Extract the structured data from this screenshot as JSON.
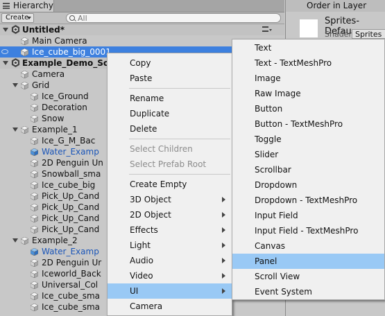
{
  "hierarchy": {
    "tab_label": "Hierarchy",
    "create_label": "Create",
    "search_placeholder": "All",
    "rows": [
      {
        "label": "Untitled*",
        "type": "scene"
      },
      {
        "label": "Main Camera",
        "type": "object"
      },
      {
        "label": "Ice_cube_big_0001",
        "type": "object",
        "selected": true
      },
      {
        "label": "Example_Demo_Sc",
        "type": "scene"
      },
      {
        "label": "Camera",
        "type": "object"
      },
      {
        "label": "Grid",
        "type": "object"
      },
      {
        "label": "Ice_Ground",
        "type": "object"
      },
      {
        "label": "Decoration",
        "type": "object"
      },
      {
        "label": "Snow",
        "type": "object"
      },
      {
        "label": "Example_1",
        "type": "object"
      },
      {
        "label": "Ice_G_M_Bac",
        "type": "object"
      },
      {
        "label": "Water_Examp",
        "type": "prefab"
      },
      {
        "label": "2D Penguin Un",
        "type": "object"
      },
      {
        "label": "Snowball_sma",
        "type": "object"
      },
      {
        "label": "Ice_cube_big",
        "type": "object"
      },
      {
        "label": "Pick_Up_Cand",
        "type": "object"
      },
      {
        "label": "Pick_Up_Cand",
        "type": "object"
      },
      {
        "label": "Pick_Up_Cand",
        "type": "object"
      },
      {
        "label": "Pick_Up_Cand",
        "type": "object"
      },
      {
        "label": "Example_2",
        "type": "object"
      },
      {
        "label": "Water_Examp",
        "type": "prefab"
      },
      {
        "label": "2D Penguin Ur",
        "type": "object"
      },
      {
        "label": "Iceworld_Back",
        "type": "object"
      },
      {
        "label": "Universal_Col",
        "type": "object"
      },
      {
        "label": "Ice_cube_sma",
        "type": "object"
      },
      {
        "label": "Ice_cube_sma",
        "type": "object"
      }
    ]
  },
  "inspector": {
    "top_label": "Order in Layer",
    "title": "Sprites-Defau",
    "shader_label": "Shader",
    "shader_value": "Sprites"
  },
  "context_menu": {
    "items": [
      {
        "label": "Copy"
      },
      {
        "label": "Paste"
      },
      {
        "label": "Rename"
      },
      {
        "label": "Duplicate"
      },
      {
        "label": "Delete"
      },
      {
        "label": "Select Children",
        "disabled": true
      },
      {
        "label": "Select Prefab Root",
        "disabled": true
      },
      {
        "label": "Create Empty"
      },
      {
        "label": "3D Object",
        "submenu": true
      },
      {
        "label": "2D Object",
        "submenu": true
      },
      {
        "label": "Effects",
        "submenu": true
      },
      {
        "label": "Light",
        "submenu": true
      },
      {
        "label": "Audio",
        "submenu": true
      },
      {
        "label": "Video",
        "submenu": true
      },
      {
        "label": "UI",
        "submenu": true,
        "highlighted": true
      },
      {
        "label": "Camera"
      }
    ]
  },
  "ui_submenu": {
    "items": [
      {
        "label": "Text"
      },
      {
        "label": "Text - TextMeshPro"
      },
      {
        "label": "Image"
      },
      {
        "label": "Raw Image"
      },
      {
        "label": "Button"
      },
      {
        "label": "Button - TextMeshPro"
      },
      {
        "label": "Toggle"
      },
      {
        "label": "Slider"
      },
      {
        "label": "Scrollbar"
      },
      {
        "label": "Dropdown"
      },
      {
        "label": "Dropdown - TextMeshPro"
      },
      {
        "label": "Input Field"
      },
      {
        "label": "Input Field - TextMeshPro"
      },
      {
        "label": "Canvas"
      },
      {
        "label": "Panel",
        "highlighted": true
      },
      {
        "label": "Scroll View"
      },
      {
        "label": "Event System"
      }
    ]
  },
  "colors": {
    "selection": "#3d80df",
    "menu_highlight": "#99c9f5",
    "prefab_text": "#1a55b8"
  }
}
